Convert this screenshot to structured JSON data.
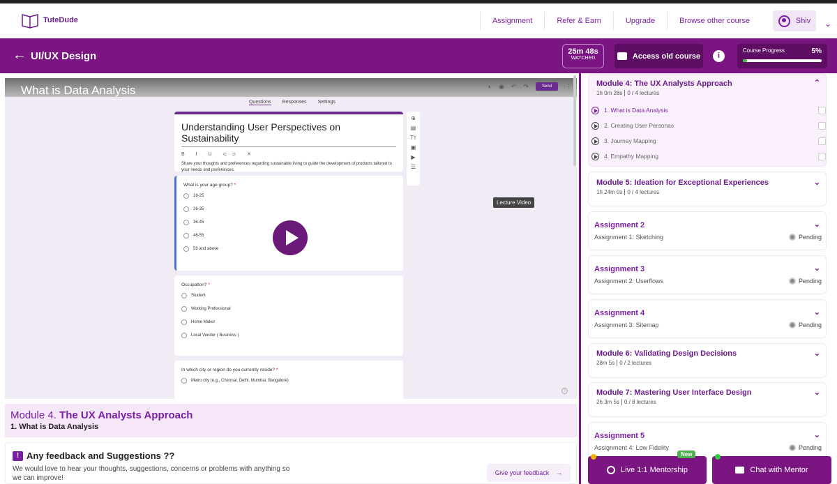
{
  "nav": {
    "logo": "TuteDude",
    "links": [
      "Assignment",
      "Refer & Earn",
      "Upgrade",
      "Browse other course"
    ],
    "user": "Shiv"
  },
  "header": {
    "title": "UI/UX Design",
    "watched_time": "25m 48s",
    "watched_label": "WATCHED",
    "old_course": "Access old course",
    "progress_label": "Course Progress",
    "progress_value": "5%",
    "progress_fraction": 0.05
  },
  "video": {
    "title": "What is Data Analysis",
    "tabs": [
      "Questions",
      "Responses",
      "Settings"
    ],
    "send": "Send",
    "tooltip": "Lecture Video",
    "form_title": "Understanding User Perspectives on Sustainability",
    "form_toolbar": "B I U ⊂⊃ ✕",
    "form_desc": "Share your thoughts and preferences regarding sustainable living to guide the development of products tailored to your needs and preferences.",
    "q1": "What is your age group?",
    "q1_opts": [
      "18-25",
      "26-35",
      "36-45",
      "46-55",
      "56 and above"
    ],
    "q2": "Occupation?",
    "q2_opts": [
      "Student",
      "Working Professional",
      "Home Maker",
      "Local Vendor ( Business )"
    ],
    "q3": "In which city or region do you currently reside?",
    "q3_opts": [
      "Metro city (e.g., Chennai, Delhi, Mumbai, Bangalore)"
    ]
  },
  "module": {
    "prefix": "Module 4.",
    "name": "The UX Analysts Approach",
    "lecture": "1. What is Data Analysis"
  },
  "feedback": {
    "title": "Any feedback and Suggestions ??",
    "desc": "We would love to hear your thoughts, suggestions, concerns or problems with anything so we can improve!",
    "button": "Give your feedback"
  },
  "sidebar": {
    "m4": {
      "title": "Module 4: The UX Analysts Approach",
      "dur": "1h 0m 28s",
      "count": "0 / 4 lectures",
      "lectures": [
        "1. What is Data Analysis",
        "2. Creating User Personas",
        "3. Journey Mapping",
        "4. Empathy Mapping"
      ]
    },
    "m5": {
      "title": "Module 5: Ideation for Exceptional Experiences",
      "dur": "1h 24m 0s",
      "count": "0 / 4 lectures"
    },
    "a2": {
      "title": "Assignment 2",
      "sub": "Assignment 1: Sketching",
      "status": "Pending"
    },
    "a3": {
      "title": "Assignment 3",
      "sub": "Assignment 2: Userflows",
      "status": "Pending"
    },
    "a4": {
      "title": "Assignment 4",
      "sub": "Assignment 3: Sitemap",
      "status": "Pending"
    },
    "m6": {
      "title": "Module 6: Validating Design Decisions",
      "dur": "28m 5s",
      "count": "0 / 2 lectures"
    },
    "m7": {
      "title": "Module 7: Mastering User Interface Design",
      "dur": "2h 3m 5s",
      "count": "0 / 8 lectures"
    },
    "a5": {
      "title": "Assignment 5",
      "sub": "Assignment 4: Low Fidelity",
      "status": "Pending"
    }
  },
  "buttons": {
    "mentorship": "Live 1:1 Mentorship",
    "new": "New",
    "chat": "Chat with Mentor"
  }
}
